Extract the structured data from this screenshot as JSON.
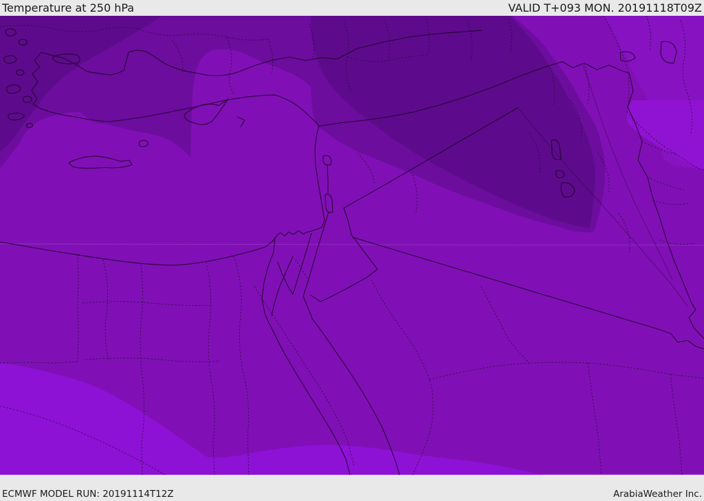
{
  "header": {
    "title": "Temperature at 250 hPa",
    "valid_label": "VALID T+093 MON. 20191118T09Z"
  },
  "footer": {
    "model_run_label": "ECMWF MODEL RUN: 20191114T12Z",
    "credit_label": "ArabiaWeather Inc."
  },
  "map": {
    "parameter": "Temperature",
    "pressure_level": "250 hPa",
    "bands": [
      {
        "name": "coldest-core",
        "color": "#5D0B8C"
      },
      {
        "name": "very-cold-band",
        "color": "#6C0D9E"
      },
      {
        "name": "base-field",
        "color": "#8010B6"
      },
      {
        "name": "milder-ne-corner",
        "color": "#8612C2"
      },
      {
        "name": "mild-east-patch",
        "color": "#9013D4"
      },
      {
        "name": "mildest-southwest",
        "color": "#8E12D6"
      }
    ],
    "line_colors": {
      "coast_border": "#1C0322",
      "admin_border": "#2A0A33",
      "river": "#24062B",
      "gridline": "rgba(244,228,255,0.32)"
    },
    "ui_colors": {
      "bar_background": "#E9E9E9",
      "bar_text": "#1A1A1A"
    }
  }
}
